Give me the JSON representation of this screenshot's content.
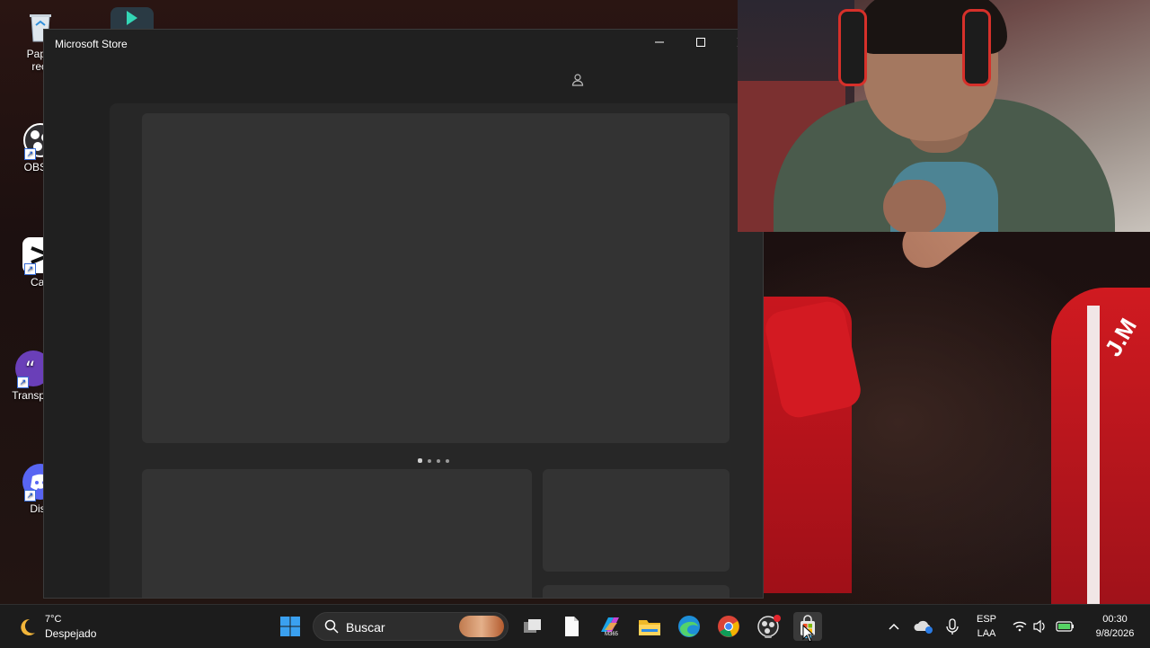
{
  "desktop": {
    "icons": [
      {
        "label": "Papel\nreci",
        "line1": "Papel",
        "line2": "reci",
        "name": "recycle-bin"
      },
      {
        "label": "OBS S",
        "line1": "OBS S",
        "line2": "",
        "name": "obs-studio"
      },
      {
        "label": "Cap",
        "line1": "Cap",
        "line2": "",
        "name": "capcut"
      },
      {
        "label": "Transpar",
        "line1": "Transpar",
        "line2": "",
        "name": "transparency-app"
      },
      {
        "label": "Disc",
        "line1": "Disc",
        "line2": "",
        "name": "discord"
      }
    ]
  },
  "window": {
    "title": "Microsoft Store",
    "minimize_glyph": "—",
    "maximize_glyph": "▢",
    "carousel": {
      "count": 4,
      "active_index": 0
    }
  },
  "wallpaper": {
    "player_text": "J.M"
  },
  "taskbar": {
    "weather": {
      "temp": "7°C",
      "condition": "Despejado",
      "icon": "moon-icon"
    },
    "search_placeholder": "Buscar",
    "apps": [
      "start",
      "task-view",
      "notepad",
      "m365-copilot",
      "file-explorer",
      "edge",
      "chrome",
      "obs",
      "microsoft-store"
    ],
    "m365_label": "M365",
    "tray": {
      "language": "ESP",
      "layout": "LAA",
      "time": "00:30",
      "date": "9/8/2026"
    }
  },
  "colors": {
    "accent": "#0078d4",
    "window_bg": "#202020",
    "card_bg": "#333333"
  }
}
